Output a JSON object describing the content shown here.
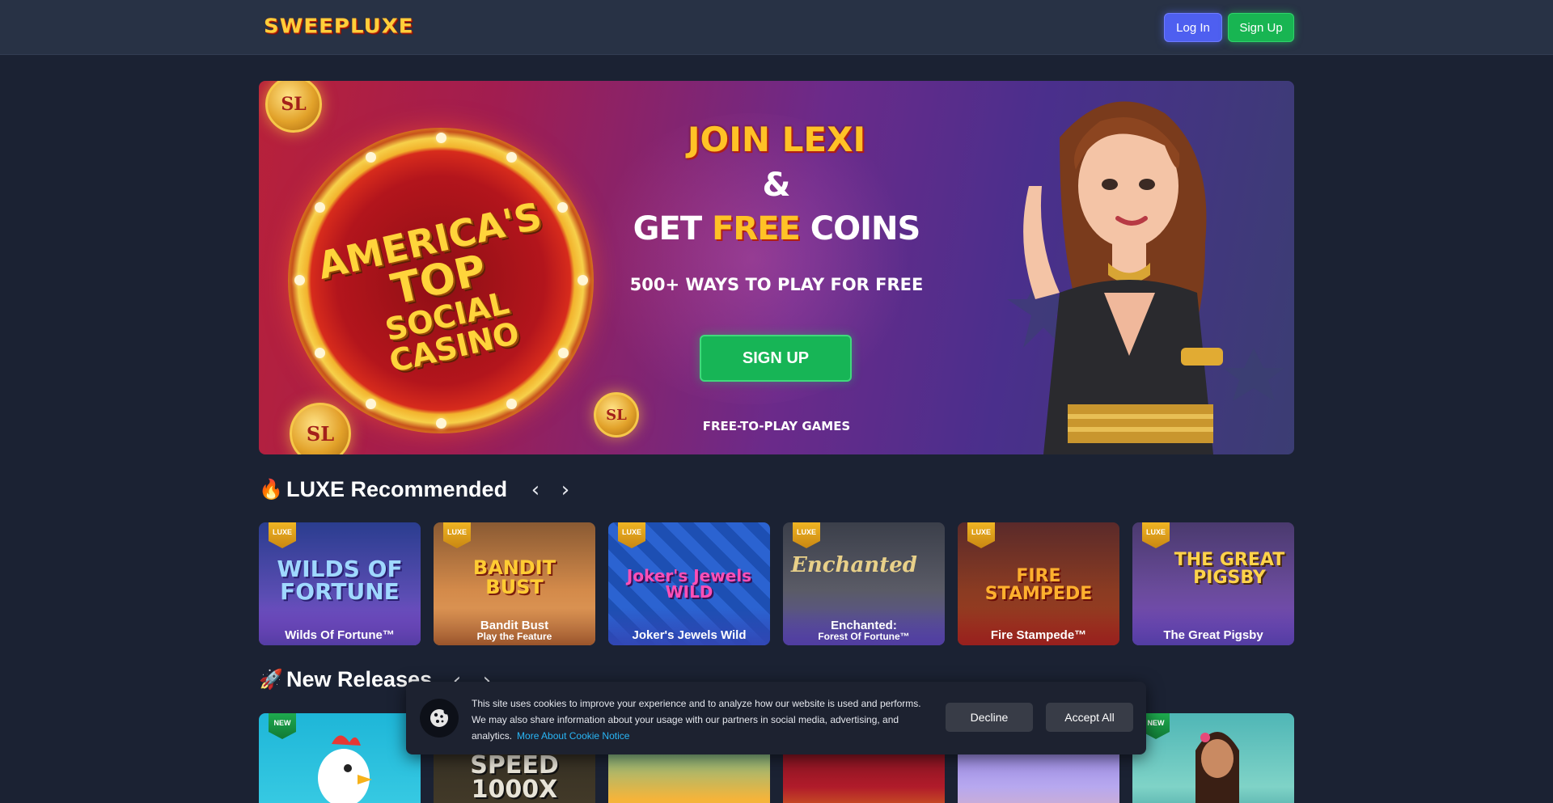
{
  "header": {
    "logo": "SWEEPLUXE",
    "login_label": "Log In",
    "signup_label": "Sign Up"
  },
  "hero": {
    "wheel_line1": "AMERICA'S",
    "wheel_line2": "TOP",
    "wheel_line3": "SOCIAL CASINO",
    "coin_text": "SL",
    "title": "JOIN LEXI",
    "amp": "&",
    "get": "GET",
    "free": "FREE",
    "coins": "COINS",
    "ways": "500+ WAYS TO PLAY FOR FREE",
    "cta_label": "SIGN UP",
    "f2p": "FREE-TO-PLAY GAMES"
  },
  "recommended": {
    "emoji": "🔥",
    "title": "LUXE Recommended",
    "prev": "‹",
    "next": "›",
    "badge": "LUXE",
    "games": [
      {
        "name": "Wilds Of Fortune™",
        "art": "WILDS OF FORTUNE",
        "sub": ""
      },
      {
        "name": "Bandit Bust",
        "art": "BANDIT BUST",
        "sub": "Play the Feature"
      },
      {
        "name": "Joker's Jewels Wild",
        "art": "Joker's Jewels WILD",
        "sub": ""
      },
      {
        "name": "Enchanted:",
        "art": "Enchanted",
        "sub": "Forest Of Fortune™"
      },
      {
        "name": "Fire Stampede™",
        "art": "FIRE STAMPEDE",
        "sub": ""
      },
      {
        "name": "The Great Pigsby",
        "art": "THE GREAT PIGSBY",
        "sub": ""
      }
    ]
  },
  "new_releases": {
    "emoji": "🚀",
    "title": "New Releases",
    "prev": "‹",
    "next": "›",
    "badge": "NEW",
    "cards": [
      {
        "art": ""
      },
      {
        "art": "SPEED 1000X"
      },
      {
        "art": ""
      },
      {
        "art": ""
      },
      {
        "art": ""
      },
      {
        "art": ""
      }
    ]
  },
  "cookie": {
    "text": "This site uses cookies to improve your experience and to analyze how our website is used and performs. We may also share information about your usage with our partners in social media, advertising, and analytics.",
    "link": "More About Cookie Notice",
    "decline": "Decline",
    "accept": "Accept All"
  },
  "colors": {
    "background": "#1b2233",
    "header": "#283245",
    "login_button": "#4e5ff0",
    "signup_button": "#18b552",
    "logo": "#ffcf3a",
    "link": "#29b6f6"
  }
}
